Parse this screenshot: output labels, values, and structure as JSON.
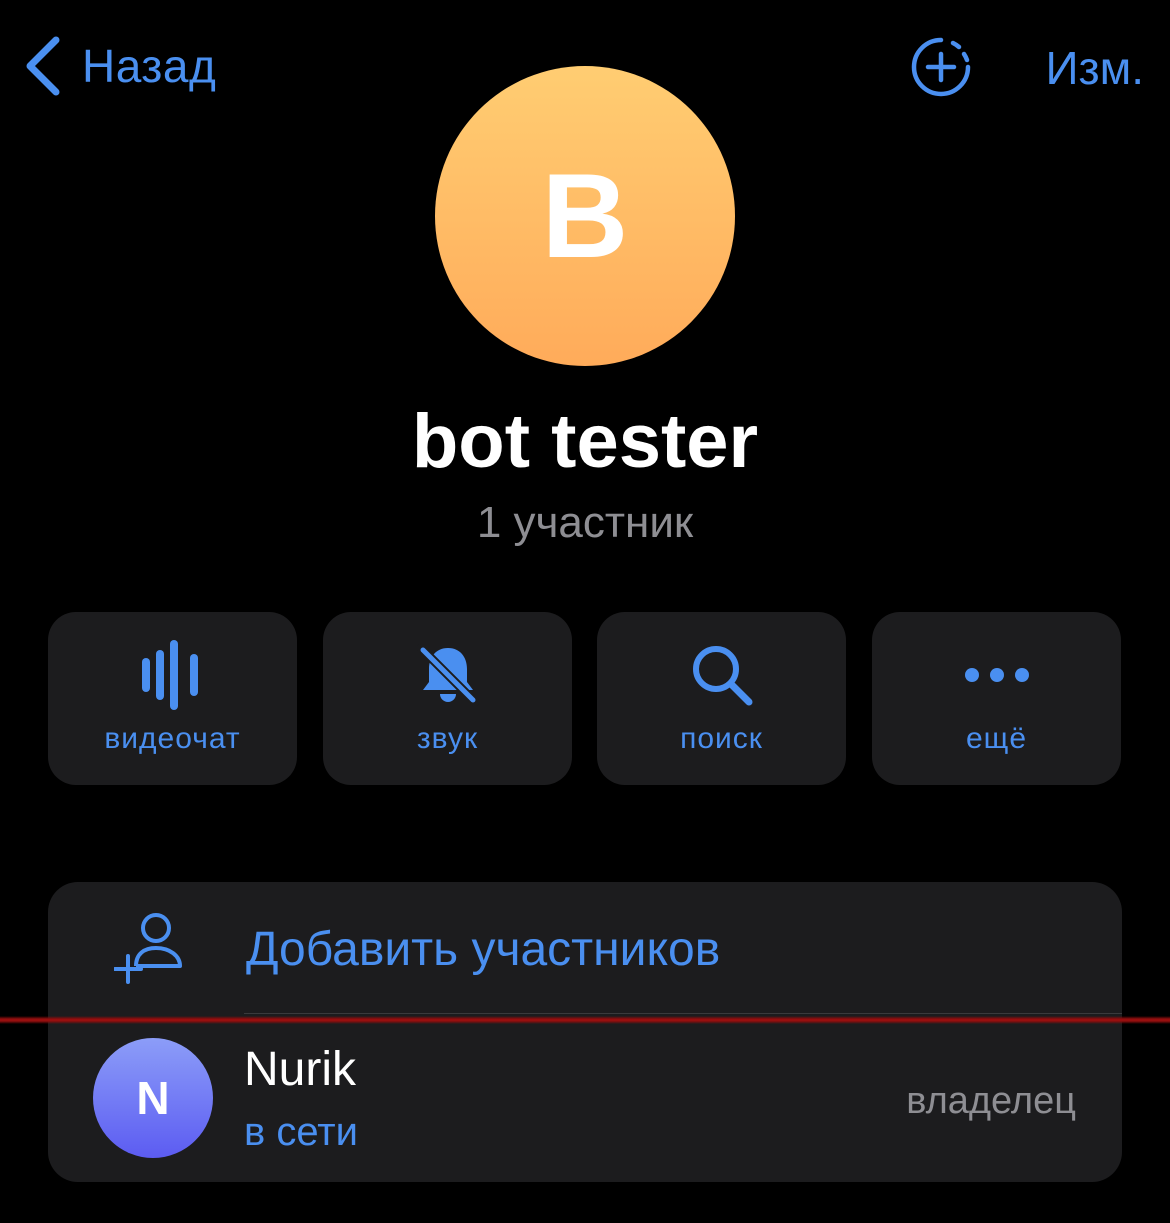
{
  "header": {
    "back_label": "Назад",
    "edit_label": "Изм."
  },
  "group": {
    "avatar_letter": "B",
    "title": "bot tester",
    "subtitle": "1 участник"
  },
  "actions": [
    {
      "label": "видеочат",
      "icon": "voice-chat-icon"
    },
    {
      "label": "звук",
      "icon": "bell-muted-icon"
    },
    {
      "label": "поиск",
      "icon": "search-icon"
    },
    {
      "label": "ещё",
      "icon": "more-dots-icon"
    }
  ],
  "members": {
    "add_label": "Добавить участников",
    "list": [
      {
        "avatar_letter": "N",
        "name": "Nurik",
        "status": "в сети",
        "role": "владелец"
      }
    ]
  },
  "colors": {
    "accent": "#4a8ff0",
    "background": "#000000",
    "card": "#1c1c1e",
    "secondary_text": "#8e8e93",
    "group_avatar_top": "#ffcd72",
    "group_avatar_bottom": "#ffab5a",
    "member_avatar_top": "#8c9df8",
    "member_avatar_bottom": "#5c5cf2"
  }
}
